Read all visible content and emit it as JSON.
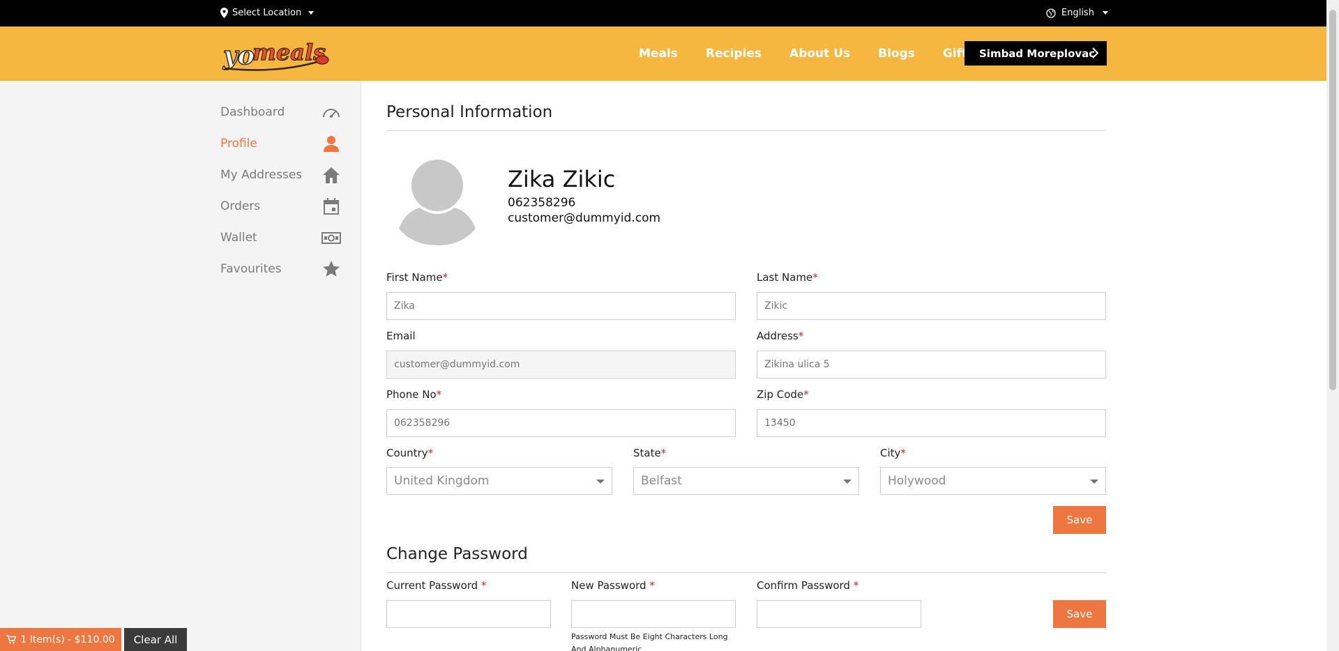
{
  "topbar": {
    "location_label": "Select Location",
    "language_label": "English"
  },
  "header": {
    "nav": [
      "Meals",
      "Recipies",
      "About Us",
      "Blogs",
      "Gift card"
    ],
    "user_name": "Simbad Moreplovac"
  },
  "sidebar": {
    "items": [
      {
        "label": "Dashboard",
        "icon": "speedometer-icon"
      },
      {
        "label": "Profile",
        "icon": "user-icon"
      },
      {
        "label": "My Addresses",
        "icon": "home-icon"
      },
      {
        "label": "Orders",
        "icon": "calendar-icon"
      },
      {
        "label": "Wallet",
        "icon": "cash-icon"
      },
      {
        "label": "Favourites",
        "icon": "star-icon"
      }
    ],
    "active": "Profile"
  },
  "profile": {
    "section_title": "Personal Information",
    "name": "Zika Zikic",
    "phone": "062358296",
    "email": "customer@dummyid.com"
  },
  "form": {
    "first_name": {
      "label": "First Name",
      "placeholder": "Zika"
    },
    "last_name": {
      "label": "Last Name",
      "placeholder": "Zikic"
    },
    "email": {
      "label": "Email",
      "placeholder": "customer@dummyid.com"
    },
    "address": {
      "label": "Address",
      "placeholder": "Zikina ulica 5"
    },
    "phone": {
      "label": "Phone No",
      "placeholder": "062358296"
    },
    "zip": {
      "label": "Zip Code",
      "placeholder": "13450"
    },
    "country": {
      "label": "Country",
      "value": "United Kingdom"
    },
    "state": {
      "label": "State",
      "value": "Belfast"
    },
    "city": {
      "label": "City",
      "value": "Holywood"
    },
    "save_label": "Save",
    "required_mark": "*"
  },
  "password": {
    "section_title": "Change Password",
    "current_label": "Current Password",
    "new_label": "New Password",
    "confirm_label": "Confirm Password",
    "hint": "Password Must Be Eight Characters Long And Alphanumeric",
    "save_label": "Save"
  },
  "cart": {
    "summary": "1 Item(s) - $110.00",
    "clear_label": "Clear All"
  },
  "colors": {
    "brand_yellow": "#f5b73f",
    "accent_orange": "#ee7640",
    "required_red": "#e02020"
  }
}
